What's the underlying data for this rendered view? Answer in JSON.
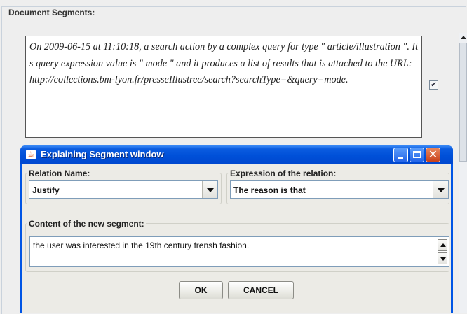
{
  "main": {
    "legend": "Document Segments:",
    "segment_text": "On 2009-06-15 at 11:10:18, a search action by a complex query for type \" article/illustration \". Its query expression value is \" mode \" and it produces a list of results that is attached to the URL: http://collections.bm-lyon.fr/presseIllustree/search?searchType=&query=mode.",
    "segment_checked": "✔"
  },
  "dialog": {
    "title": "Explaining Segment window",
    "app_icon": "java-icon",
    "relation_name": {
      "label": "Relation Name:",
      "selected": "Justify"
    },
    "expression": {
      "label": "Expression of the relation:",
      "selected": "The reason is that"
    },
    "content": {
      "label": "Content of the new segment:",
      "value": "the user was interested in the 19th century frensh fashion."
    },
    "buttons": {
      "ok": "OK",
      "cancel": "CANCEL"
    },
    "close_glyph": "✕"
  }
}
